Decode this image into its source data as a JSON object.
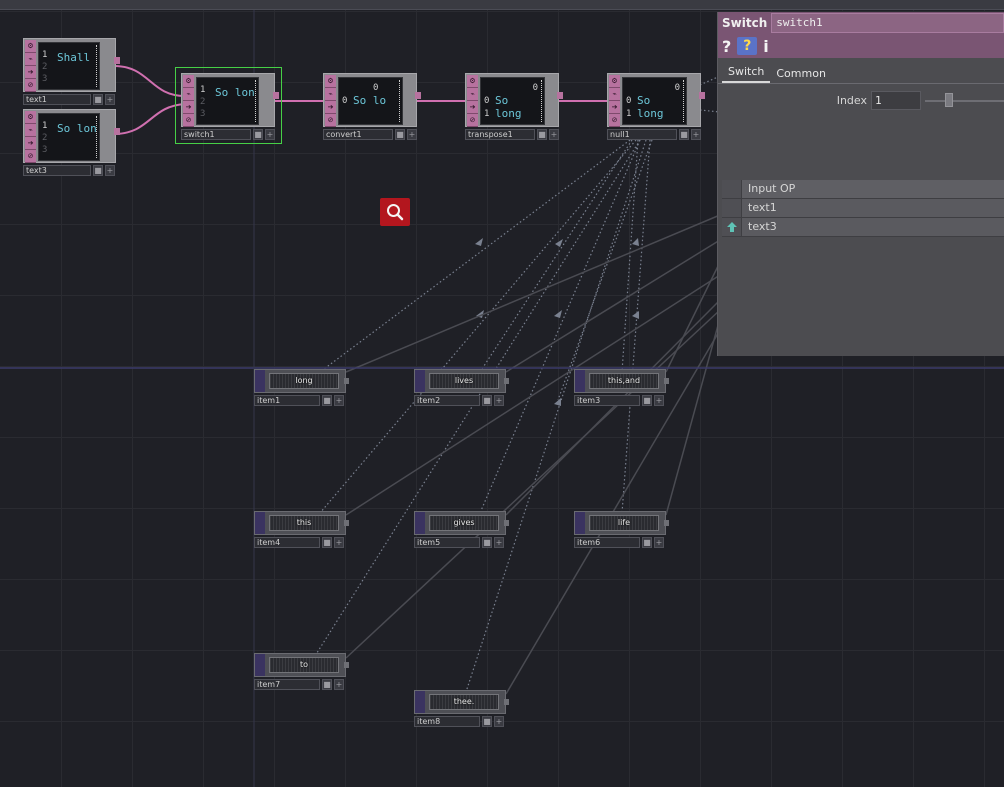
{
  "network": {
    "operators": [
      {
        "id": "text1",
        "label": "text1",
        "lines": [
          "1",
          "2",
          "3"
        ],
        "text": "Shall"
      },
      {
        "id": "text3",
        "label": "text3",
        "lines": [
          "1",
          "2",
          "3"
        ],
        "text": "So lon"
      },
      {
        "id": "switch1",
        "label": "switch1",
        "lines": [
          "1",
          "2",
          "3"
        ],
        "text": "So lon"
      },
      {
        "id": "convert1",
        "label": "convert1",
        "header": "0",
        "rows": [
          {
            "idx": "0",
            "cells": "So   lo"
          }
        ]
      },
      {
        "id": "transpose1",
        "label": "transpose1",
        "header": "0",
        "rows": [
          {
            "idx": "0",
            "cells": "So"
          },
          {
            "idx": "1",
            "cells": "long"
          }
        ]
      },
      {
        "id": "null1",
        "label": "null1",
        "header": "0",
        "rows": [
          {
            "idx": "0",
            "cells": "So"
          },
          {
            "idx": "1",
            "cells": "long"
          }
        ]
      }
    ],
    "items": [
      {
        "label": "item1",
        "text": "long"
      },
      {
        "label": "item2",
        "text": "lives"
      },
      {
        "label": "item3",
        "text": "this,and"
      },
      {
        "label": "item4",
        "text": "this"
      },
      {
        "label": "item5",
        "text": "gives"
      },
      {
        "label": "item6",
        "text": "life"
      },
      {
        "label": "item7",
        "text": "to"
      },
      {
        "label": "item8",
        "text": "thee."
      }
    ],
    "selected_operator": "switch1",
    "colors": {
      "dat_operator": "#b7729f",
      "selection": "#46d046",
      "wire": "#d070b0",
      "search_button": "#b3161e"
    }
  },
  "panel": {
    "op_type": "Switch",
    "op_name": "switch1",
    "toolbar": {
      "help": "?",
      "python_help": "?",
      "info": "i"
    },
    "tabs": [
      {
        "label": "Switch",
        "active": true
      },
      {
        "label": "Common",
        "active": false
      }
    ],
    "params": {
      "index_label": "Index",
      "index_value": "1"
    },
    "inputs": {
      "header": "Input OP",
      "rows": [
        "text1",
        "text3"
      ],
      "active_row": "text3"
    }
  }
}
